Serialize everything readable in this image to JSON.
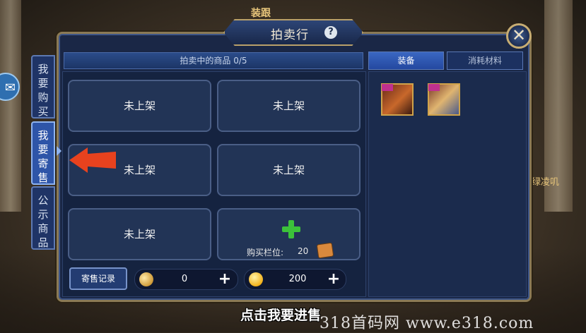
{
  "background": {
    "sign_text": "装跟",
    "side_text": "绿凌叽"
  },
  "window": {
    "title": "拍卖行",
    "help_icon": "?",
    "close_icon": "✕"
  },
  "side_tabs": [
    {
      "label": "我要购买",
      "active": false
    },
    {
      "label": "我要寄售",
      "active": true
    },
    {
      "label": "公示商品",
      "active": false
    }
  ],
  "selling_header": "拍卖中的商品 0/5",
  "slots": [
    {
      "label": "未上架"
    },
    {
      "label": "未上架"
    },
    {
      "label": "未上架"
    },
    {
      "label": "未上架"
    },
    {
      "label": "未上架"
    }
  ],
  "add_slot": {
    "cost_label": "购买栏位:",
    "cost_value": "20"
  },
  "category_tabs": [
    {
      "label": "装备",
      "active": true
    },
    {
      "label": "消耗材料",
      "active": false
    }
  ],
  "inventory_items": [
    {
      "name": "equipment-item-1",
      "badge": ""
    },
    {
      "name": "equipment-item-2",
      "badge": ""
    }
  ],
  "record_button": "寄售记录",
  "currencies": [
    {
      "icon": "silver-coin-icon",
      "value": "0"
    },
    {
      "icon": "gold-coin-icon",
      "value": "200"
    }
  ],
  "subtitle": "点击我要进售",
  "watermark": "318首码网  www.e318.com",
  "colors": {
    "panel_bg": "#1a2746",
    "accent_gold": "#c7ad73",
    "active_tab": "#2e55a8",
    "add_plus": "#3cc23a",
    "arrow_red": "#e8421e"
  }
}
